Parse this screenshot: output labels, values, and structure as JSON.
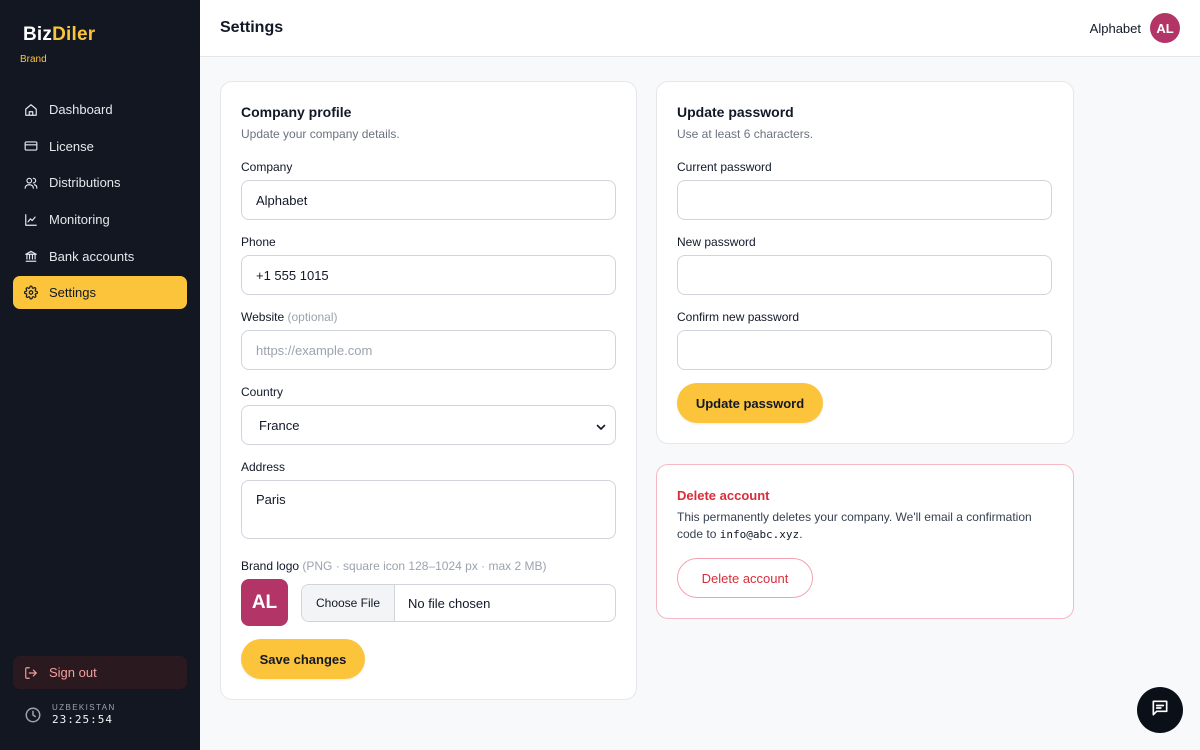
{
  "sidebar": {
    "brand_part1": "Biz",
    "brand_part2": "Diler",
    "brand_sub": "Brand",
    "items": [
      {
        "label": "Dashboard",
        "icon": "home-icon"
      },
      {
        "label": "License",
        "icon": "card-icon"
      },
      {
        "label": "Distributions",
        "icon": "users-icon"
      },
      {
        "label": "Monitoring",
        "icon": "chart-icon"
      },
      {
        "label": "Bank accounts",
        "icon": "bank-icon"
      },
      {
        "label": "Settings",
        "icon": "gear-icon",
        "active": true
      }
    ],
    "signout_label": "Sign out",
    "clock": {
      "timezone": "UZBEKISTAN",
      "time": "23:25:54"
    }
  },
  "header": {
    "title": "Settings",
    "user_name": "Alphabet",
    "avatar_initials": "AL"
  },
  "company_profile": {
    "title": "Company profile",
    "subtitle": "Update your company details.",
    "company_label": "Company",
    "company_value": "Alphabet",
    "phone_label": "Phone",
    "phone_value": "+1 555 1015",
    "website_label": "Website",
    "website_optional": "(optional)",
    "website_placeholder": "https://example.com",
    "country_label": "Country",
    "country_value": "France",
    "address_label": "Address",
    "address_value": "Paris",
    "logo_label": "Brand logo",
    "logo_hint": "(PNG · square icon 128–1024 px · max 2 MB)",
    "logo_initials": "AL",
    "choose_file_label": "Choose File",
    "file_status": "No file chosen",
    "save_label": "Save changes"
  },
  "password": {
    "title": "Update password",
    "subtitle": "Use at least 6 characters.",
    "current_label": "Current password",
    "new_label": "New password",
    "confirm_label": "Confirm new password",
    "button_label": "Update password"
  },
  "delete_account": {
    "title": "Delete account",
    "text_before": "This permanently deletes your company. We'll email a confirmation code to ",
    "email": "info@abc.xyz",
    "text_after": ".",
    "button_label": "Delete account"
  },
  "colors": {
    "accent": "#fbc43a",
    "sidebar_bg": "#121722",
    "danger": "#d92d3a",
    "avatar": "#b33567"
  }
}
